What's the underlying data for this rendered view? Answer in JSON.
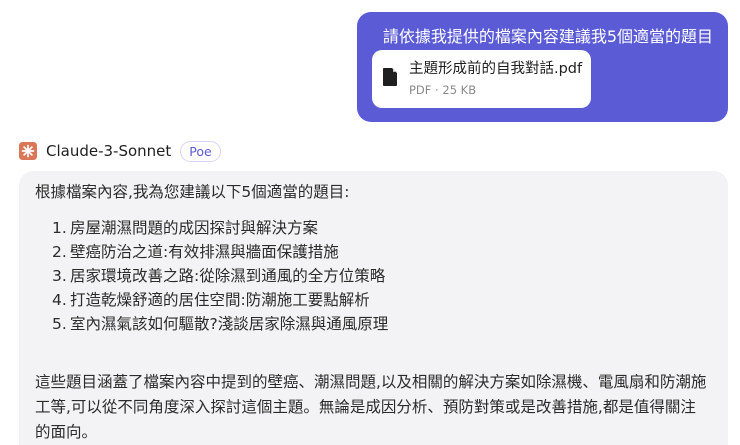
{
  "user_message": {
    "text": "請依據我提供的檔案內容建議我5個適當的題目",
    "attachment": {
      "icon": "document-icon",
      "name": "主題形成前的自我對話.pdf",
      "meta": "PDF · 25 KB"
    }
  },
  "bot": {
    "name": "Claude-3-Sonnet",
    "badge": "Poe",
    "avatar_color": "#d97757"
  },
  "response": {
    "intro": "根據檔案內容,我為您建議以下5個適當的題目:",
    "items": [
      {
        "num": "1.",
        "text": "房屋潮濕問題的成因探討與解決方案"
      },
      {
        "num": "2.",
        "text": "壁癌防治之道:有效排濕與牆面保護措施"
      },
      {
        "num": "3.",
        "text": "居家環境改善之路:從除濕到通風的全方位策略"
      },
      {
        "num": "4.",
        "text": "打造乾燥舒適的居住空間:防潮施工要點解析"
      },
      {
        "num": "5.",
        "text": "室內濕氣該如何驅散?淺談居家除濕與通風原理"
      }
    ],
    "summary": "這些題目涵蓋了檔案內容中提到的壁癌、潮濕問題,以及相關的解決方案如除濕機、電風扇和防潮施工等,可以從不同角度深入探討這個主題。無論是成因分析、預防對策或是改善措施,都是值得關注的面向。"
  },
  "colors": {
    "user_bubble": "#5b5bd6",
    "bot_bubble": "#f3f3f5",
    "badge_text": "#5b5bd6"
  }
}
